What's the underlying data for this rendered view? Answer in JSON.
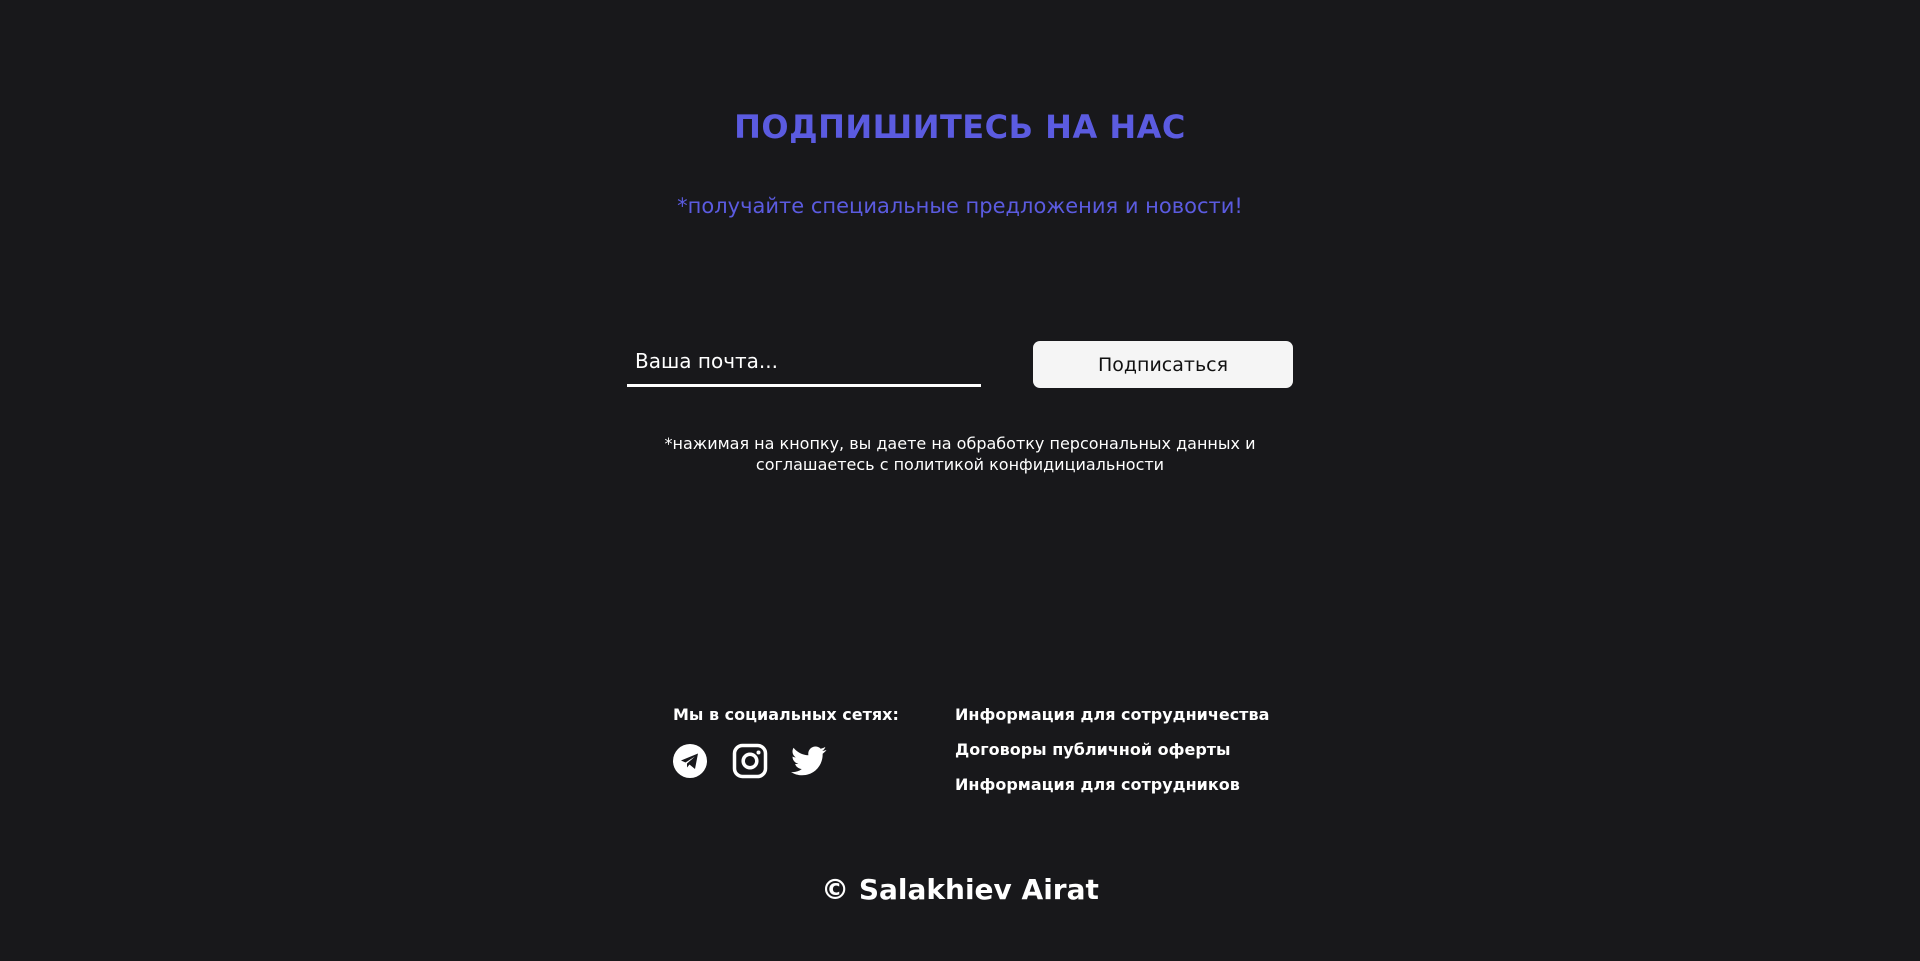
{
  "subscribe": {
    "title": "ПОДПИШИТЕСЬ НА НАС",
    "subtitle": "*получайте специальные предложения и новости!",
    "email_placeholder": "Ваша почта...",
    "email_value": "",
    "button_label": "Подписаться",
    "consent_line1": "*нажимая на кнопку, вы даете на обработку персональных данных и",
    "consent_line2": "соглашаетесь с политикой конфидициальности"
  },
  "footer": {
    "social_title": "Мы в социальных сетях:",
    "social_icons": [
      "telegram-icon",
      "instagram-icon",
      "twitter-icon"
    ],
    "links": [
      "Информация для сотрудничества",
      "Договоры публичной оферты",
      "Информация для сотрудников"
    ],
    "copyright": "© Salakhiev Airat"
  },
  "colors": {
    "background": "#18181b",
    "accent": "#5b5be0",
    "text": "#ffffff",
    "button_bg": "#f5f5f5"
  }
}
